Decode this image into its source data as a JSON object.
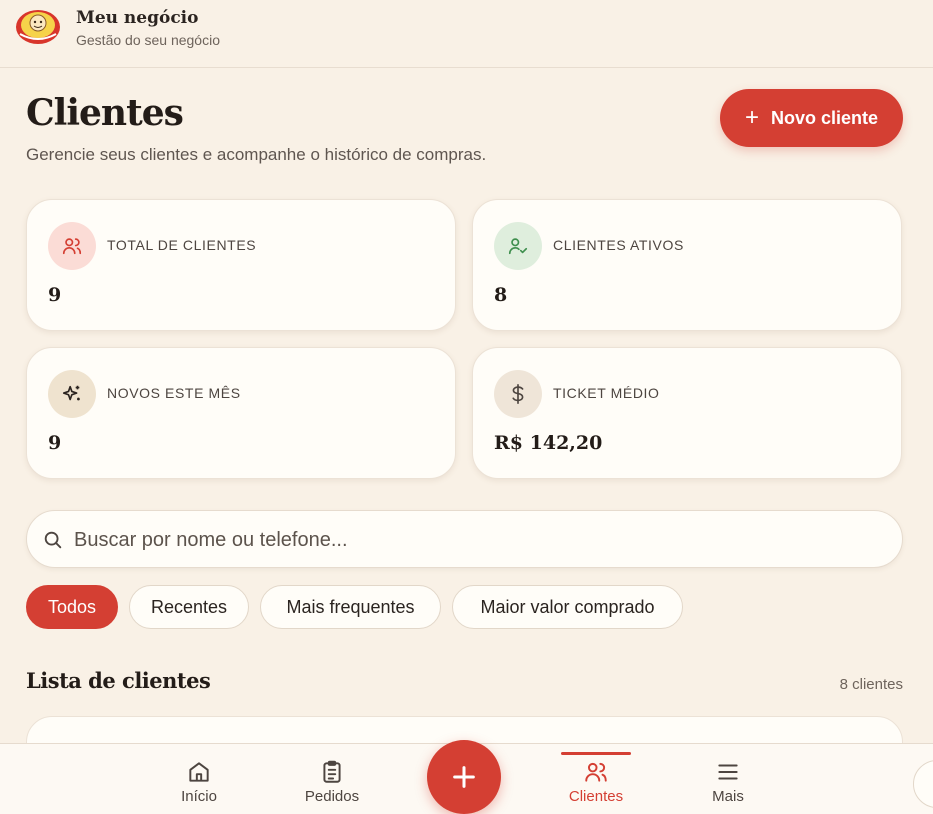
{
  "brand": {
    "name": "Meu negócio",
    "subtitle": "Gestão do seu negócio"
  },
  "page": {
    "title": "Clientes",
    "subtitle": "Gerencie seus clientes e acompanhe o histórico de compras.",
    "new_button_label": "Novo cliente"
  },
  "stats": [
    {
      "label": "TOTAL DE CLIENTES",
      "value": "9",
      "icon": "users-icon",
      "icon_bg": "#fbdcd6",
      "icon_color": "#d43f33"
    },
    {
      "label": "CLIENTES ATIVOS",
      "value": "8",
      "icon": "user-check-icon",
      "icon_bg": "#dfeedd",
      "icon_color": "#3f8f4e"
    },
    {
      "label": "NOVOS ESTE MÊS",
      "value": "9",
      "icon": "sparkles-icon",
      "icon_bg": "#efe3cf",
      "icon_color": "#2b2420"
    },
    {
      "label": "TICKET MÉDIO",
      "value": "R$ 142,20",
      "icon": "dollar-icon",
      "icon_bg": "#efe5d8",
      "icon_color": "#4d4540"
    }
  ],
  "search": {
    "placeholder": "Buscar por nome ou telefone...",
    "value": ""
  },
  "filters": {
    "active": "Todos",
    "items": [
      "Todos",
      "Recentes",
      "Mais frequentes",
      "Maior valor comprado"
    ]
  },
  "list": {
    "title": "Lista de clientes",
    "count_label": "8 clientes"
  },
  "nav": {
    "active": "Clientes",
    "items": [
      {
        "label": "Início",
        "icon": "home-icon"
      },
      {
        "label": "Pedidos",
        "icon": "clipboard-icon"
      },
      {
        "label": "Clientes",
        "icon": "users-icon"
      },
      {
        "label": "Mais",
        "icon": "menu-icon"
      }
    ],
    "fab_icon": "plus-icon"
  },
  "colors": {
    "accent": "#d43f33",
    "background": "#f9f1e6",
    "card": "#fffdf8"
  }
}
